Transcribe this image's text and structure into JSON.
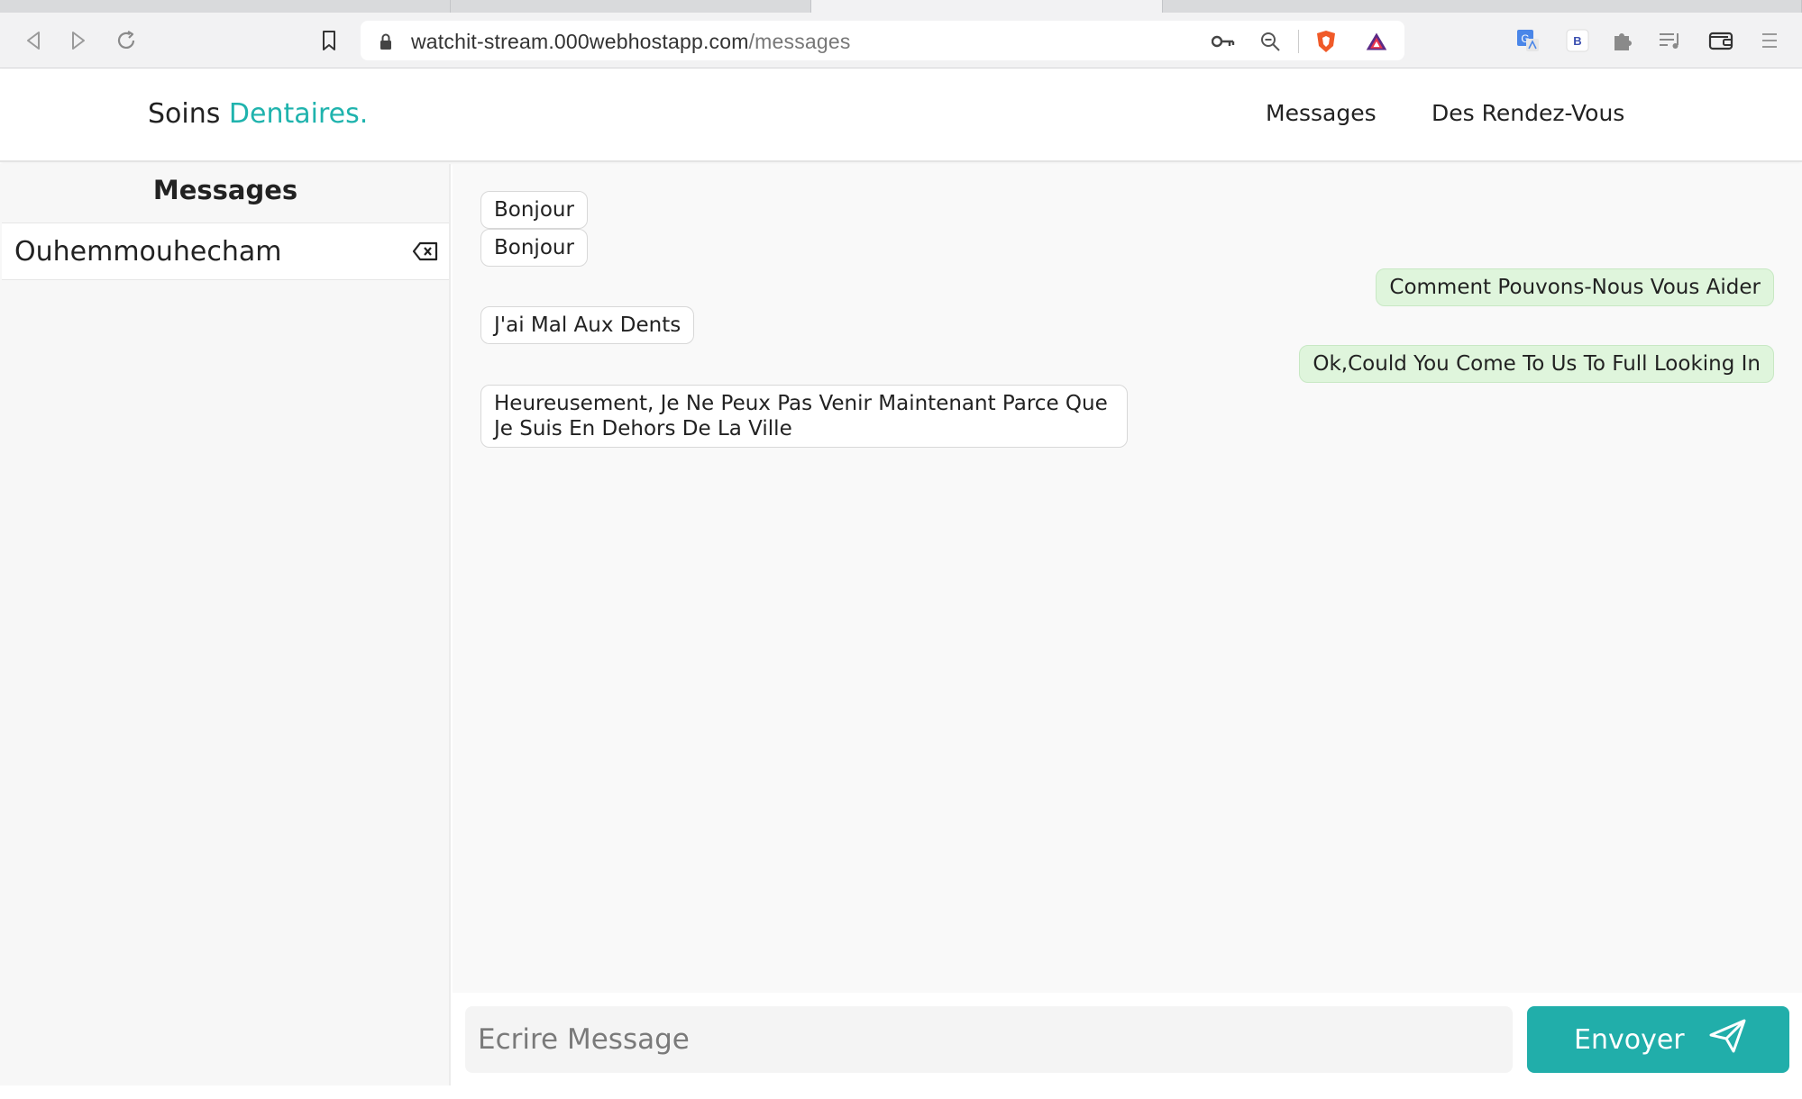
{
  "browser": {
    "url_host": "watchit-stream.000webhostapp.com",
    "url_path": "/messages"
  },
  "site": {
    "brand_main": "Soins ",
    "brand_accent": "Dentaires.",
    "accent_color": "#1fb3ad",
    "nav": {
      "messages": "Messages",
      "appointments": "Des Rendez-Vous"
    }
  },
  "sidebar": {
    "title": "Messages",
    "contacts": [
      {
        "name": "Ouhemmouhecham"
      }
    ]
  },
  "chat": {
    "messages": [
      {
        "from": "patient",
        "text": "Bonjour"
      },
      {
        "from": "patient",
        "text": "Bonjour"
      },
      {
        "from": "clinic",
        "text": "Comment Pouvons-Nous Vous Aider"
      },
      {
        "from": "patient",
        "text": "J'ai Mal Aux Dents"
      },
      {
        "from": "clinic",
        "text": "Ok,Could You Come To Us To Full Looking In"
      },
      {
        "from": "patient",
        "text": "Heureusement, Je Ne Peux Pas Venir Maintenant Parce Que Je Suis En Dehors De La Ville"
      }
    ]
  },
  "composer": {
    "placeholder": "Ecrire Message",
    "send_label": "Envoyer",
    "button_color": "#21aeaa"
  }
}
